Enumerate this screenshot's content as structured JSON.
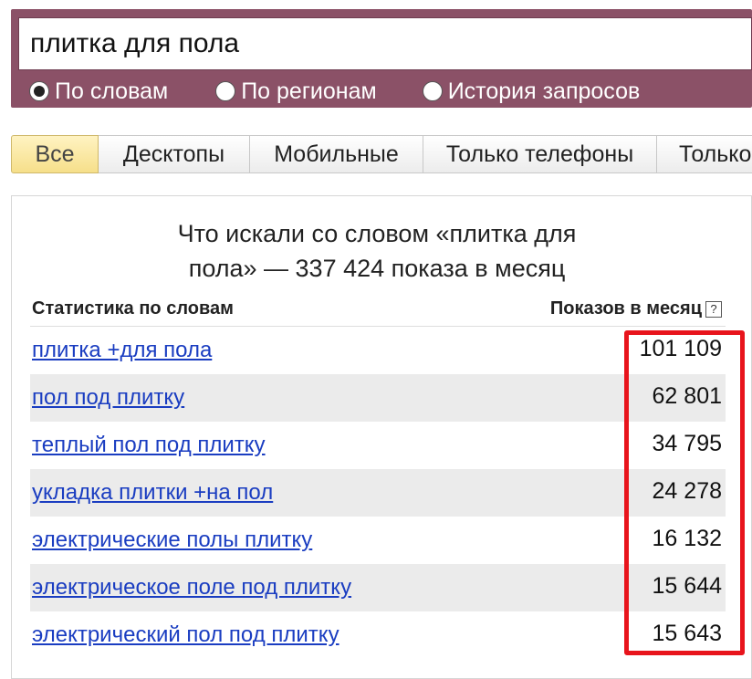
{
  "search": {
    "query": "плитка для пола",
    "options": [
      {
        "label": "По словам",
        "checked": true
      },
      {
        "label": "По регионам",
        "checked": false
      },
      {
        "label": "История запросов",
        "checked": false
      }
    ]
  },
  "tabs": [
    "Все",
    "Десктопы",
    "Мобильные",
    "Только телефоны",
    "Только"
  ],
  "panel": {
    "title_line1": "Что искали со словом «плитка для",
    "title_line2": "пола» — 337 424 показа в месяц",
    "col_left": "Статистика по словам",
    "col_right": "Показов в месяц",
    "help": "?"
  },
  "rows": [
    {
      "phrase": "плитка +для пола",
      "count": "101 109"
    },
    {
      "phrase": "пол под плитку",
      "count": "62 801"
    },
    {
      "phrase": "теплый пол под плитку",
      "count": "34 795"
    },
    {
      "phrase": "укладка плитки +на пол",
      "count": "24 278"
    },
    {
      "phrase": "электрические полы плитку",
      "count": "16 132"
    },
    {
      "phrase": "электрическое поле под плитку",
      "count": "15 644"
    },
    {
      "phrase": "электрический пол под плитку",
      "count": "15 643"
    }
  ],
  "colors": {
    "header_bg": "#8b5167",
    "link": "#1a3dc1",
    "highlight": "#e8141c",
    "active_tab": "#f6df8a"
  }
}
